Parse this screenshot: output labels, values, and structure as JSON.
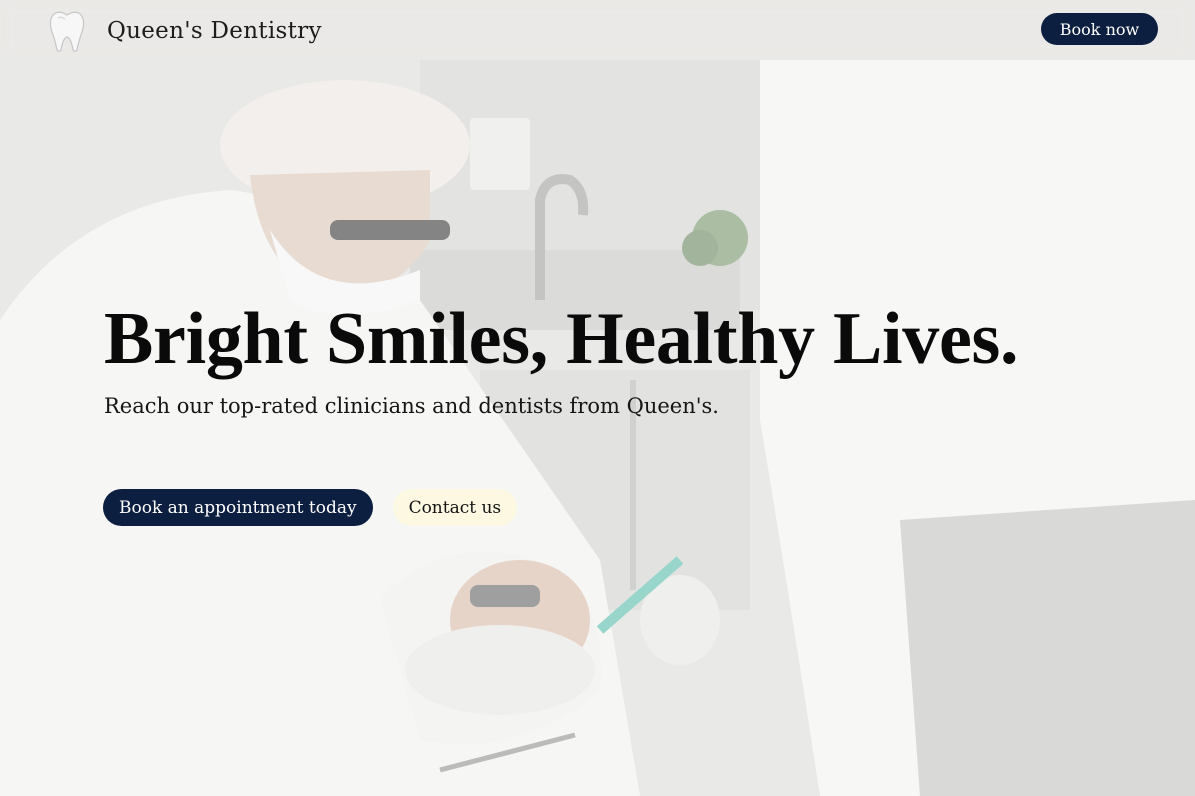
{
  "header": {
    "brand_name": "Queen's Dentistry",
    "logo_icon": "tooth-icon",
    "book_now_label": "Book now"
  },
  "hero": {
    "title": "Bright Smiles, Healthy Lives.",
    "subtitle": "Reach our top-rated clinicians and dentists from Queen's.",
    "primary_cta_label": "Book an appointment today",
    "secondary_cta_label": "Contact us"
  },
  "colors": {
    "navy": "#0d1f40",
    "cream": "#fdf8e1",
    "text": "#0a0a0a"
  }
}
